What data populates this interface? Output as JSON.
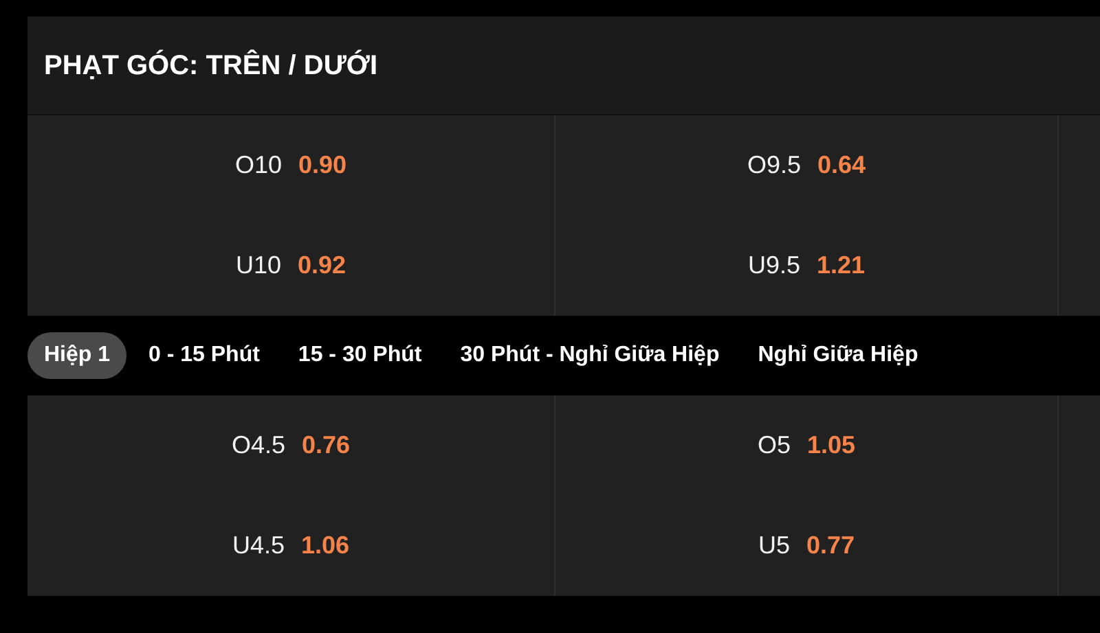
{
  "market": {
    "title": "PHẠT GÓC: TRÊN / DƯỚI",
    "rows": [
      [
        {
          "line": "O10",
          "odds": "0.90"
        },
        {
          "line": "O9.5",
          "odds": "0.64"
        }
      ],
      [
        {
          "line": "U10",
          "odds": "0.92"
        },
        {
          "line": "U9.5",
          "odds": "1.21"
        }
      ]
    ]
  },
  "tabs": [
    {
      "label": "Hiệp 1",
      "selected": true
    },
    {
      "label": "0 - 15 Phút",
      "selected": false
    },
    {
      "label": "15 - 30 Phút",
      "selected": false
    },
    {
      "label": "30 Phút - Nghỉ Giữa Hiệp",
      "selected": false
    },
    {
      "label": "Nghỉ Giữa Hiệp",
      "selected": false
    }
  ],
  "period_market": {
    "rows": [
      [
        {
          "line": "O4.5",
          "odds": "0.76"
        },
        {
          "line": "O5",
          "odds": "1.05"
        }
      ],
      [
        {
          "line": "U4.5",
          "odds": "1.06"
        },
        {
          "line": "U5",
          "odds": "0.77"
        }
      ]
    ]
  }
}
